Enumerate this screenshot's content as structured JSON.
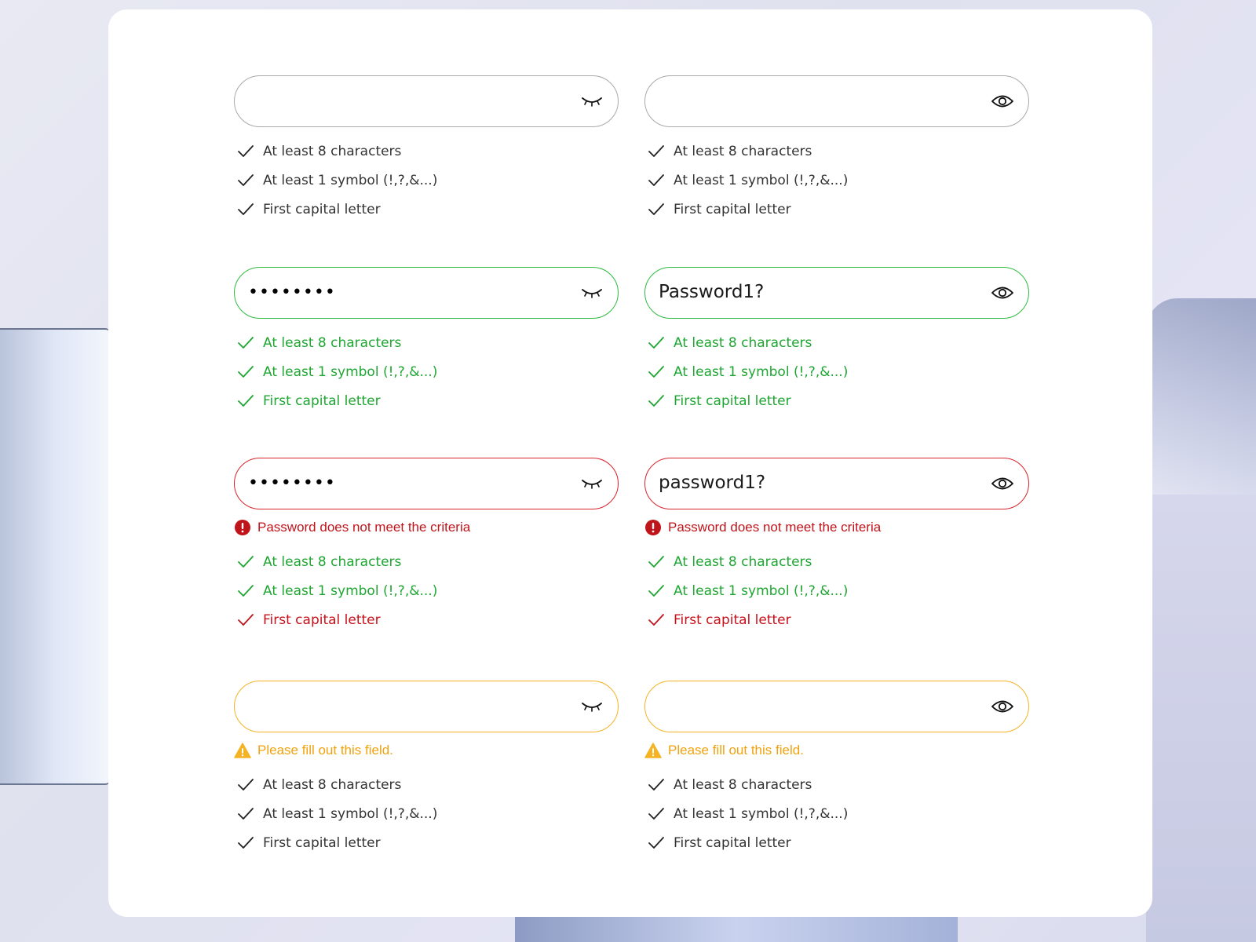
{
  "colors": {
    "neutral_border": "#a9a9a9",
    "valid": "#2dbb3f",
    "valid_text": "#1fa632",
    "error": "#d8232a",
    "error_text": "#c0141b",
    "warning": "#f5b324",
    "warning_text": "#f0a20f",
    "neutral_text": "#333333"
  },
  "criteria_labels": {
    "length": "At least 8 characters",
    "symbol": "At least 1 symbol (!,?,&...)",
    "capital": "First capital letter"
  },
  "rows": [
    {
      "state": "default",
      "left": {
        "value": "",
        "visibility_icon": "eye-closed-icon"
      },
      "right": {
        "value": "",
        "visibility_icon": "eye-open-icon"
      },
      "message": null,
      "criteria_status": [
        "neutral",
        "neutral",
        "neutral"
      ]
    },
    {
      "state": "valid",
      "left": {
        "value": "••••••••",
        "visibility_icon": "eye-closed-icon"
      },
      "right": {
        "value": "Password1?",
        "visibility_icon": "eye-open-icon"
      },
      "message": null,
      "criteria_status": [
        "ok",
        "ok",
        "ok"
      ]
    },
    {
      "state": "error",
      "left": {
        "value": "••••••••",
        "visibility_icon": "eye-closed-icon"
      },
      "right": {
        "value": "password1?",
        "visibility_icon": "eye-open-icon"
      },
      "message": {
        "type": "error",
        "icon": "error-circle-icon",
        "text": "Password does not meet the criteria"
      },
      "criteria_status": [
        "ok",
        "ok",
        "fail"
      ]
    },
    {
      "state": "warning",
      "left": {
        "value": "",
        "visibility_icon": "eye-closed-icon"
      },
      "right": {
        "value": "",
        "visibility_icon": "eye-open-icon"
      },
      "message": {
        "type": "warning",
        "icon": "warning-triangle-icon",
        "text": "Please fill out this field."
      },
      "criteria_status": [
        "neutral",
        "neutral",
        "neutral"
      ]
    }
  ]
}
